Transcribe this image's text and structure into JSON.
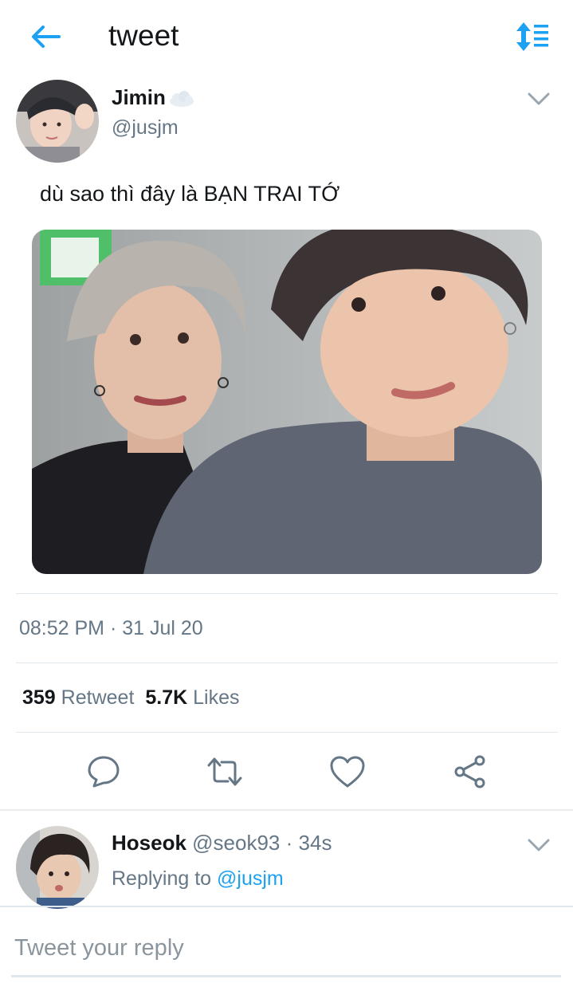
{
  "header": {
    "title": "tweet"
  },
  "tweet": {
    "author_name": "Jimin",
    "author_handle": "@jusjm",
    "text": "dù sao thì đây là BẠN TRAI TỚ",
    "timestamp": "08:52 PM · 31 Jul 20",
    "retweet_count": "359",
    "retweet_label": "Retweet",
    "like_count": "5.7K",
    "like_label": "Likes"
  },
  "reply": {
    "author_name": "Hoseok",
    "author_handle": "@seok93",
    "separator": "·",
    "time": "34s",
    "replying_prefix": "Replying to",
    "replying_to": "@jusjm"
  },
  "composer": {
    "placeholder": "Tweet your reply"
  },
  "colors": {
    "accent": "#1da1f2",
    "text_primary": "#14171a",
    "text_secondary": "#657786",
    "divider": "#e1e8ed"
  },
  "icons": {
    "back": "arrow-left-icon",
    "sort": "sort-list-icon",
    "caret": "chevron-down-icon",
    "reply": "speech-bubble-icon",
    "retweet": "retweet-icon",
    "like": "heart-icon",
    "share": "share-icon"
  }
}
